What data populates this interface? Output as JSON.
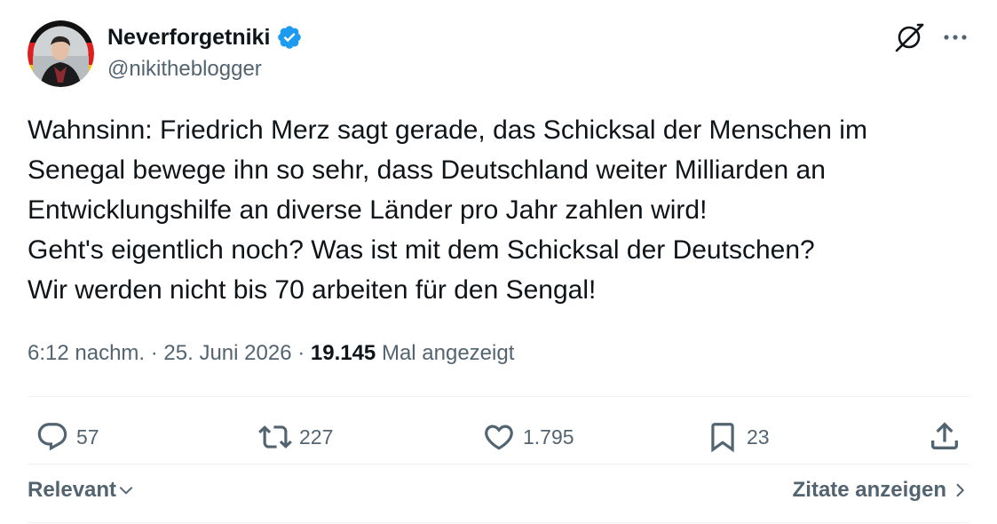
{
  "author": {
    "display_name": "Neverforgetniki",
    "handle": "@nikitheblogger",
    "verified": true
  },
  "tweet": {
    "lines": [
      "Wahnsinn: Friedrich Merz sagt gerade, das Schicksal der Menschen im",
      "Senegal bewege ihn so sehr, dass Deutschland weiter Milliarden an",
      "Entwicklungshilfe an diverse Länder pro Jahr zahlen wird!",
      "Geht's eigentlich noch? Was ist mit dem Schicksal der Deutschen?",
      "Wir werden nicht bis 70 arbeiten für den Sengal!"
    ]
  },
  "meta": {
    "time": "6:12 nachm.",
    "separator": " · ",
    "date": "25. Juni 2026",
    "views_count": "19.145",
    "views_label": "Mal angezeigt"
  },
  "actions": {
    "replies": "57",
    "reposts": "227",
    "likes": "1.795",
    "bookmarks": "23"
  },
  "footer": {
    "sort_label": "Relevant",
    "quotes_label": "Zitate anzeigen"
  },
  "icons": {
    "verified": "verified-badge-icon",
    "grok": "grok-icon",
    "more": "more-icon",
    "reply": "reply-icon",
    "repost": "repost-icon",
    "like": "heart-icon",
    "bookmark": "bookmark-icon",
    "share": "share-icon"
  },
  "colors": {
    "verified_blue": "#1d9bf0",
    "text_primary": "#0f1419",
    "text_secondary": "#536471",
    "divider": "#eff3f4"
  }
}
